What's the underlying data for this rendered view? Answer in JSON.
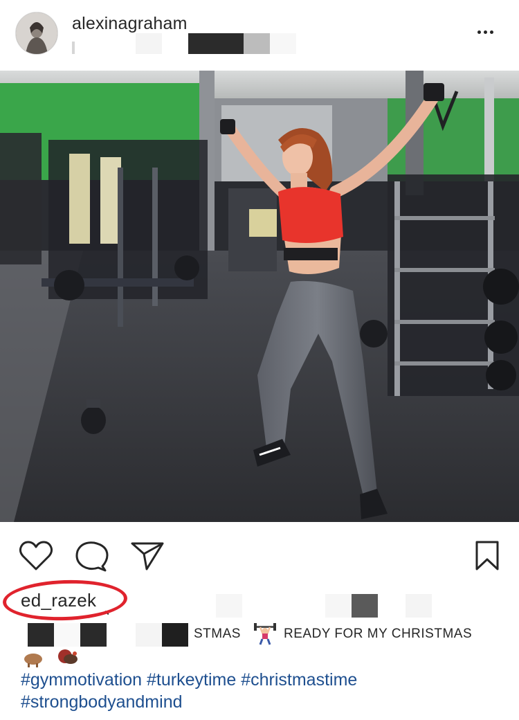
{
  "post": {
    "username": "alexinagraham",
    "more_icon": "ellipsis-icon"
  },
  "actions": {
    "like_icon": "heart-icon",
    "comment_icon": "comment-icon",
    "share_icon": "paper-plane-icon",
    "save_icon": "bookmark-icon"
  },
  "caption": {
    "mention": "ed_razek",
    "line2_fragment": "STMAS",
    "line3": "READY FOR MY CHRISTMAS",
    "hashtags": [
      "#gymmotivation",
      "#turkeytime",
      "#christmastime",
      "#strongbodyandmind"
    ]
  },
  "colors": {
    "annotation_circle": "#e0232d",
    "hashtag": "#1e4f8f",
    "sports_bra": "#e8342c"
  }
}
